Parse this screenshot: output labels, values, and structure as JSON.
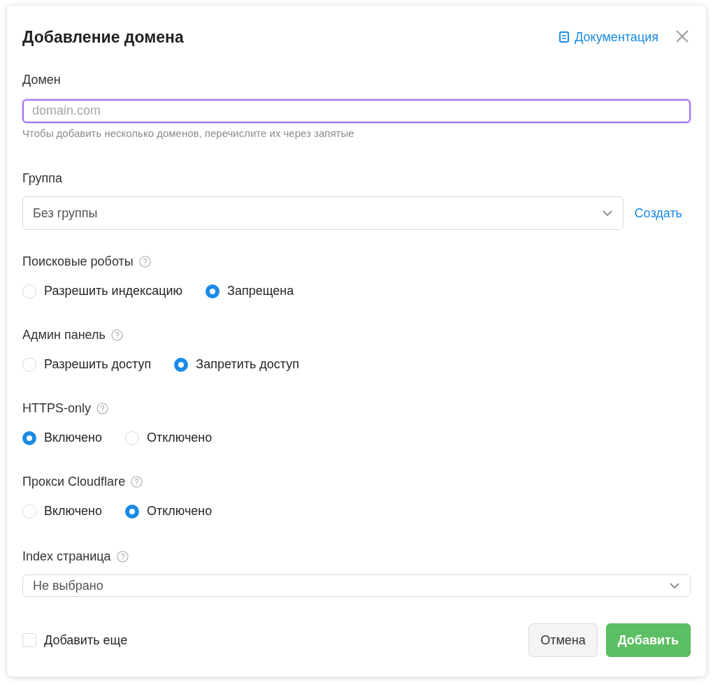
{
  "title": "Добавление домена",
  "docs_link": "Документация",
  "domain": {
    "label": "Домен",
    "placeholder": "domain.com",
    "hint": "Чтобы добавить несколько доменов, перечислите их через запятые"
  },
  "group": {
    "label": "Группа",
    "value": "Без группы",
    "create_link": "Создать"
  },
  "radio_groups": [
    {
      "label": "Поисковые роботы",
      "options": [
        {
          "label": "Разрешить индексацию",
          "selected": false
        },
        {
          "label": "Запрещена",
          "selected": true
        }
      ]
    },
    {
      "label": "Админ панель",
      "options": [
        {
          "label": "Разрешить доступ",
          "selected": false
        },
        {
          "label": "Запретить доступ",
          "selected": true
        }
      ]
    },
    {
      "label": "HTTPS-only",
      "options": [
        {
          "label": "Включено",
          "selected": true
        },
        {
          "label": "Отключено",
          "selected": false
        }
      ]
    },
    {
      "label": "Прокси Cloudflare",
      "options": [
        {
          "label": "Включено",
          "selected": false
        },
        {
          "label": "Отключено",
          "selected": true
        }
      ]
    }
  ],
  "index_page": {
    "label": "Index страница",
    "value": "Не выбрано"
  },
  "add_more": {
    "label": "Добавить еще",
    "checked": false
  },
  "buttons": {
    "cancel": "Отмена",
    "submit": "Добавить"
  }
}
